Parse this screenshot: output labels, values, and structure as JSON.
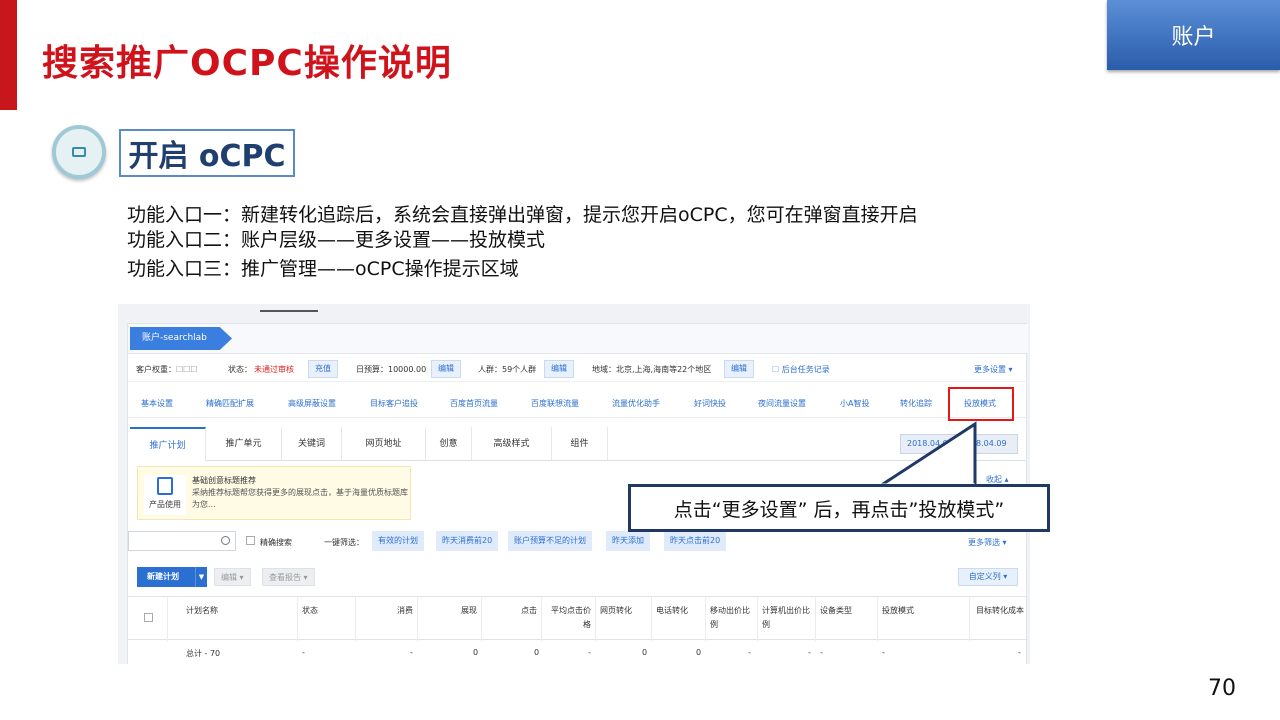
{
  "slide": {
    "title": "搜索推广OCPC操作说明",
    "corner_tab": "账户",
    "section_label": "开启 oCPC",
    "entries": [
      "功能入口一：新建转化追踪后，系统会直接弹出弹窗，提示您开启oCPC，您可在弹窗直接开启",
      "功能入口二：账户层级——更多设置——投放模式",
      "功能入口三：推广管理——oCPC操作提示区域"
    ],
    "callout": "点击“更多设置” 后，再点击”投放模式”",
    "page_number": "70",
    "colors": {
      "title_red": "#d0121b",
      "accent_blue": "#2b6fd1",
      "callout_border": "#1f3864",
      "highlight_red": "#e01919"
    }
  },
  "screenshot": {
    "breadcrumb": "账户-searchlab",
    "info": {
      "budget_label": "客户权重：",
      "status_label": "状态：",
      "status_value": "未通过审核",
      "recharge_btn": "充值",
      "daily_budget": "日预算：10000.00",
      "edit": "编辑",
      "crowd": "人群：59个人群",
      "region": "地域：北京,上海,海南等22个地区",
      "task_log": "后台任务记录",
      "more_settings": "更多设置 ▾"
    },
    "links": [
      "基本设置",
      "精确匹配扩展",
      "高级屏蔽设置",
      "目标客户追投",
      "百度首页流量",
      "百度联想流量",
      "流量优化助手",
      "好词快投",
      "夜间流量设置",
      "小A智投",
      "转化追踪",
      "投放模式"
    ],
    "tabs": [
      "推广计划",
      "推广单元",
      "关键词",
      "网页地址",
      "创意",
      "高级样式",
      "组件"
    ],
    "date_range": "2018.04.09 - 2018.04.09",
    "tip": {
      "icon_label": "产品使用",
      "title": "基础创意标题推荐",
      "body": "采纳推荐标题帮您获得更多的展现点击，基于海量优质标题库为您..."
    },
    "collapse": "收起 ▴",
    "filter": {
      "precise": "精确搜索",
      "quick_label": "一键筛选：",
      "chips": [
        "有效的计划",
        "昨天消费前20",
        "账户预算不足的计划",
        "昨天添加",
        "昨天点击前20"
      ],
      "more": "更多筛选 ▾"
    },
    "actions": {
      "new_plan": "新建计划",
      "edit": "编辑",
      "report": "查看报告",
      "custom_columns": "自定义列"
    },
    "columns": [
      "计划名称",
      "状态",
      "消费",
      "展现",
      "点击",
      "平均点击价格",
      "网页转化",
      "电话转化",
      "移动出价比例",
      "计算机出价比例",
      "设备类型",
      "投放模式",
      "目标转化成本"
    ],
    "total_row": [
      "总计 - 70",
      "-",
      "-",
      "0",
      "0",
      "-",
      "0",
      "0",
      "-",
      "-",
      "-",
      "-",
      "-"
    ]
  }
}
